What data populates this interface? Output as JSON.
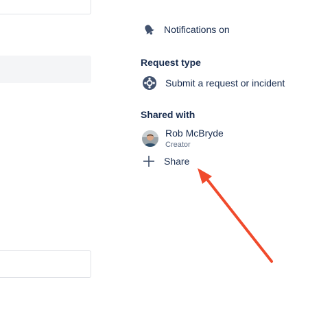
{
  "sidebar": {
    "notifications_label": "Notifications on",
    "request_type_title": "Request type",
    "request_type_value": "Submit a request or incident",
    "shared_with_title": "Shared with",
    "users": [
      {
        "name": "Rob McBryde",
        "role": "Creator"
      }
    ],
    "share_label": "Share"
  },
  "icons": {
    "notifications": "bell-icon",
    "request_type": "lifebuoy-icon",
    "share": "plus-icon"
  },
  "colors": {
    "text": "#172b4d",
    "subtle_text": "#5e6c84",
    "annotation_arrow": "#f04a2c"
  }
}
